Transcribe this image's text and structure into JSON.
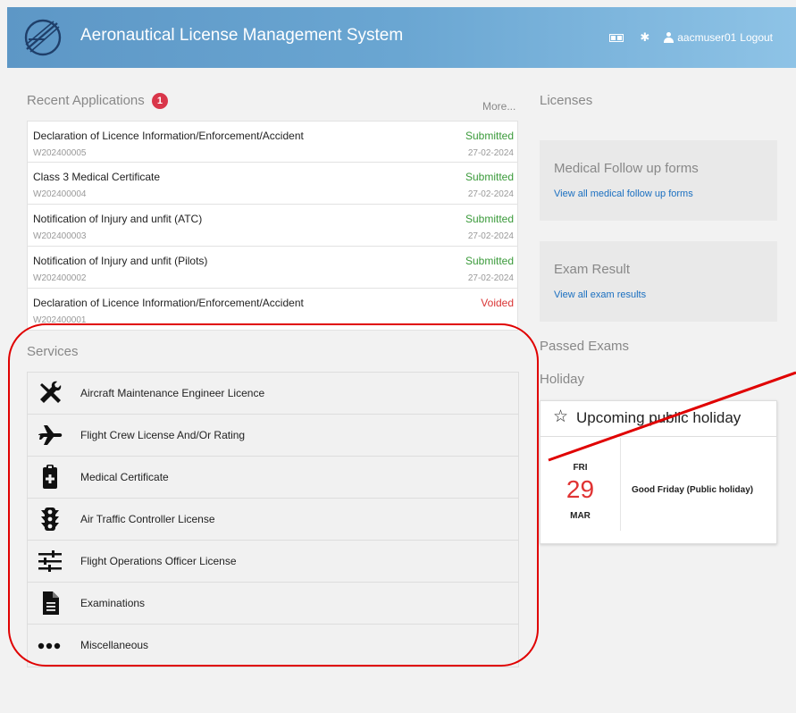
{
  "header": {
    "title": "Aeronautical License Management System",
    "logo": "aircraft-logo",
    "lang_icon": "language-icon",
    "settings_icon": "gear-icon",
    "user_icon": "user-icon",
    "username": "aacmuser01",
    "logout": "Logout"
  },
  "recent": {
    "title": "Recent Applications",
    "badge": "1",
    "more": "More...",
    "items": [
      {
        "name": "Declaration of Licence Information/Enforcement/Accident",
        "code": "W202400005",
        "status": "Submitted",
        "date": "27-02-2024"
      },
      {
        "name": "Class 3 Medical Certificate",
        "code": "W202400004",
        "status": "Submitted",
        "date": "27-02-2024"
      },
      {
        "name": "Notification of Injury and unfit (ATC)",
        "code": "W202400003",
        "status": "Submitted",
        "date": "27-02-2024"
      },
      {
        "name": "Notification of Injury and unfit (Pilots)",
        "code": "W202400002",
        "status": "Submitted",
        "date": "27-02-2024"
      },
      {
        "name": "Declaration of Licence Information/Enforcement/Accident",
        "code": "W202400001",
        "status": "Voided",
        "date": ""
      }
    ]
  },
  "services": {
    "title": "Services",
    "items": [
      {
        "label": "Aircraft Maintenance Engineer Licence",
        "icon": "tools-icon"
      },
      {
        "label": "Flight Crew License And/Or Rating",
        "icon": "airplane-icon"
      },
      {
        "label": "Medical Certificate",
        "icon": "medical-clipboard-icon"
      },
      {
        "label": "Air Traffic Controller License",
        "icon": "traffic-light-icon"
      },
      {
        "label": "Flight Operations Officer License",
        "icon": "sliders-icon"
      },
      {
        "label": "Examinations",
        "icon": "document-icon"
      },
      {
        "label": "Miscellaneous",
        "icon": "ellipsis-icon"
      }
    ]
  },
  "right": {
    "licenses": "Licenses",
    "medical_title": "Medical Follow up forms",
    "medical_link": "View all medical follow up forms",
    "exam_title": "Exam Result",
    "exam_link": "View all exam results",
    "passed": "Passed Exams",
    "holiday": "Holiday"
  },
  "holiday_card": {
    "title": "Upcoming public holiday",
    "icon": "star-icon",
    "day": "FRI",
    "date": "29",
    "month": "MAR",
    "name": "Good Friday (Public holiday)"
  },
  "colors": {
    "header_start": "#5d97c6",
    "header_end": "#8ec3e6",
    "submitted": "#3a9a3a",
    "voided": "#d93535",
    "link": "#1a6fc0",
    "badge": "#d9364a",
    "annotation": "#e00000"
  }
}
